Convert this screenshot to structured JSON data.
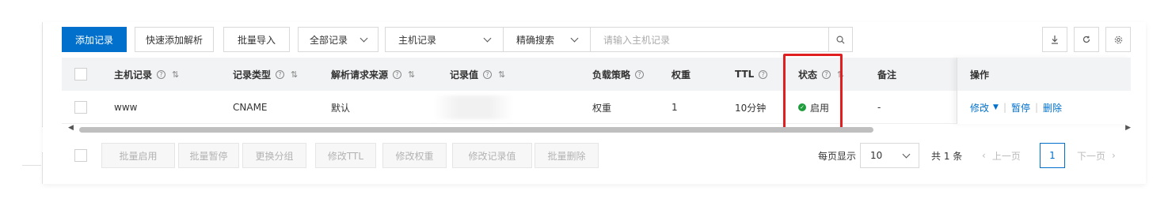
{
  "toolbar": {
    "add_record": "添加记录",
    "quick_add": "快速添加解析",
    "batch_import": "批量导入",
    "record_filter": "全部记录",
    "field_select": "主机记录",
    "match_select": "精确搜索",
    "search_placeholder": "请输入主机记录"
  },
  "table": {
    "headers": {
      "host": "主机记录",
      "type": "记录类型",
      "source": "解析请求来源",
      "value": "记录值",
      "policy": "负载策略",
      "weight": "权重",
      "ttl": "TTL",
      "status": "状态",
      "remark": "备注",
      "actions": "操作"
    },
    "rows": [
      {
        "host": "www",
        "type": "CNAME",
        "source": "默认",
        "value": "",
        "policy": "权重",
        "weight": "1",
        "ttl": "10分钟",
        "status": "启用",
        "remark": "-",
        "action_modify": "修改",
        "action_pause": "暂停",
        "action_delete": "删除"
      }
    ]
  },
  "batch": {
    "enable": "批量启用",
    "pause": "批量暂停",
    "change_group": "更换分组",
    "modify_ttl": "修改TTL",
    "modify_weight": "修改权重",
    "modify_value": "修改记录值",
    "delete": "批量删除"
  },
  "pagination": {
    "per_page_label": "每页显示",
    "per_page_value": "10",
    "total": "共 1 条",
    "prev": "上一页",
    "current": "1",
    "next": "下一页"
  },
  "colors": {
    "primary": "#0070cc",
    "status_enabled": "#1f9d3d",
    "highlight": "#e02020"
  },
  "icons": [
    "download-icon",
    "refresh-icon",
    "settings-icon",
    "search-icon",
    "help-icon",
    "sort-icon",
    "check-icon",
    "caret-down-icon",
    "chevron-left-icon"
  ]
}
